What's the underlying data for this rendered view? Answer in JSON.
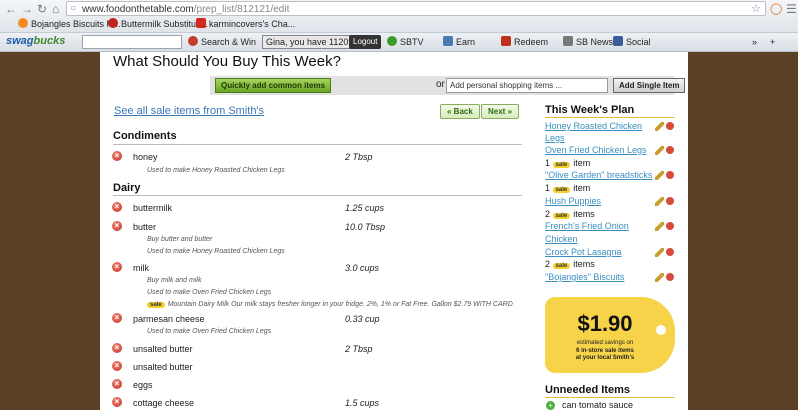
{
  "browser": {
    "url_host": "www.foodonthetable.com",
    "url_path": "/prep_list/812121/edit"
  },
  "bookmarks": [
    {
      "label": "Bojangles Biscuits R..."
    },
    {
      "label": "Buttermilk Substituti..."
    },
    {
      "label": "karmincovers's Cha..."
    }
  ],
  "toolbar": {
    "logo_a": "swag",
    "logo_b": "bucks",
    "search_win": "Search & Win",
    "greeting": "Gina, you have 1120 SB",
    "logout": "Logout",
    "sbtv": "SBTV",
    "earn": "Earn",
    "redeem": "Redeem",
    "news": "SB News",
    "social": "Social"
  },
  "page": {
    "title": "What Should You Buy This Week?",
    "quick_add": "Quickly add common items",
    "or": "or",
    "add_placeholder": "Add personal shopping items ...",
    "add_single": "Add Single Item",
    "see_all": "See all sale items from Smith's",
    "back": "« Back",
    "next": "Next »"
  },
  "categories": [
    {
      "name": "Condiments"
    },
    {
      "name": "Dairy"
    }
  ],
  "items": [
    {
      "name": "honey",
      "qty": "2 Tbsp",
      "notes": [
        "Used to make Honey Roasted Chicken Legs"
      ]
    },
    {
      "name": "buttermilk",
      "qty": "1.25 cups",
      "notes": []
    },
    {
      "name": "butter",
      "qty": "10.0 Tbsp",
      "notes": [
        "Buy butter and butter",
        "Used to make Honey Roasted Chicken Legs"
      ]
    },
    {
      "name": "milk",
      "qty": "3.0 cups",
      "notes": [
        "Buy milk and milk",
        "Used to make Oven Fried Chicken Legs"
      ],
      "sale_badge": "sale",
      "sale_text": "Mountain Dairy Milk Our milk stays fresher longer in your fridge. 2%, 1% or Fat Free. Gallon $2.79 WITH CARD"
    },
    {
      "name": "parmesan cheese",
      "qty": "0.33 cup",
      "notes": [
        "Used to make Oven Fried Chicken Legs"
      ]
    },
    {
      "name": "unsalted butter",
      "qty": "2 Tbsp",
      "notes": []
    },
    {
      "name": "unsalted butter",
      "qty": "",
      "notes": []
    },
    {
      "name": "eggs",
      "qty": "",
      "notes": []
    },
    {
      "name": "cottage cheese",
      "qty": "1.5 cups",
      "notes": []
    }
  ],
  "plan": {
    "title": "This Week's Plan",
    "rows": [
      {
        "l1": "Honey Roasted Chicken",
        "l2": "Legs"
      },
      {
        "l1": "Oven Fried Chicken Legs",
        "count": "1",
        "unit": "item"
      },
      {
        "l1": "\"Olive Garden\" breadsticks",
        "count": "1",
        "unit": "item"
      },
      {
        "l1": "Hush Puppies",
        "count": "2",
        "unit": "items"
      },
      {
        "l1": "French's Fried Onion",
        "l2": "Chicken"
      },
      {
        "l1": "Crock Pot Lasagna",
        "count": "2",
        "unit": "items"
      },
      {
        "l1": "\"Bojangles\" Biscuits"
      }
    ],
    "sale_badge": "sale"
  },
  "savings": {
    "amount": "$1.90",
    "line1": "estimated savings on",
    "line2": "6 in-store sale items",
    "line3": "at your local Smith's"
  },
  "unneeded": {
    "title": "Unneeded Items",
    "item": "can tomato sauce"
  }
}
